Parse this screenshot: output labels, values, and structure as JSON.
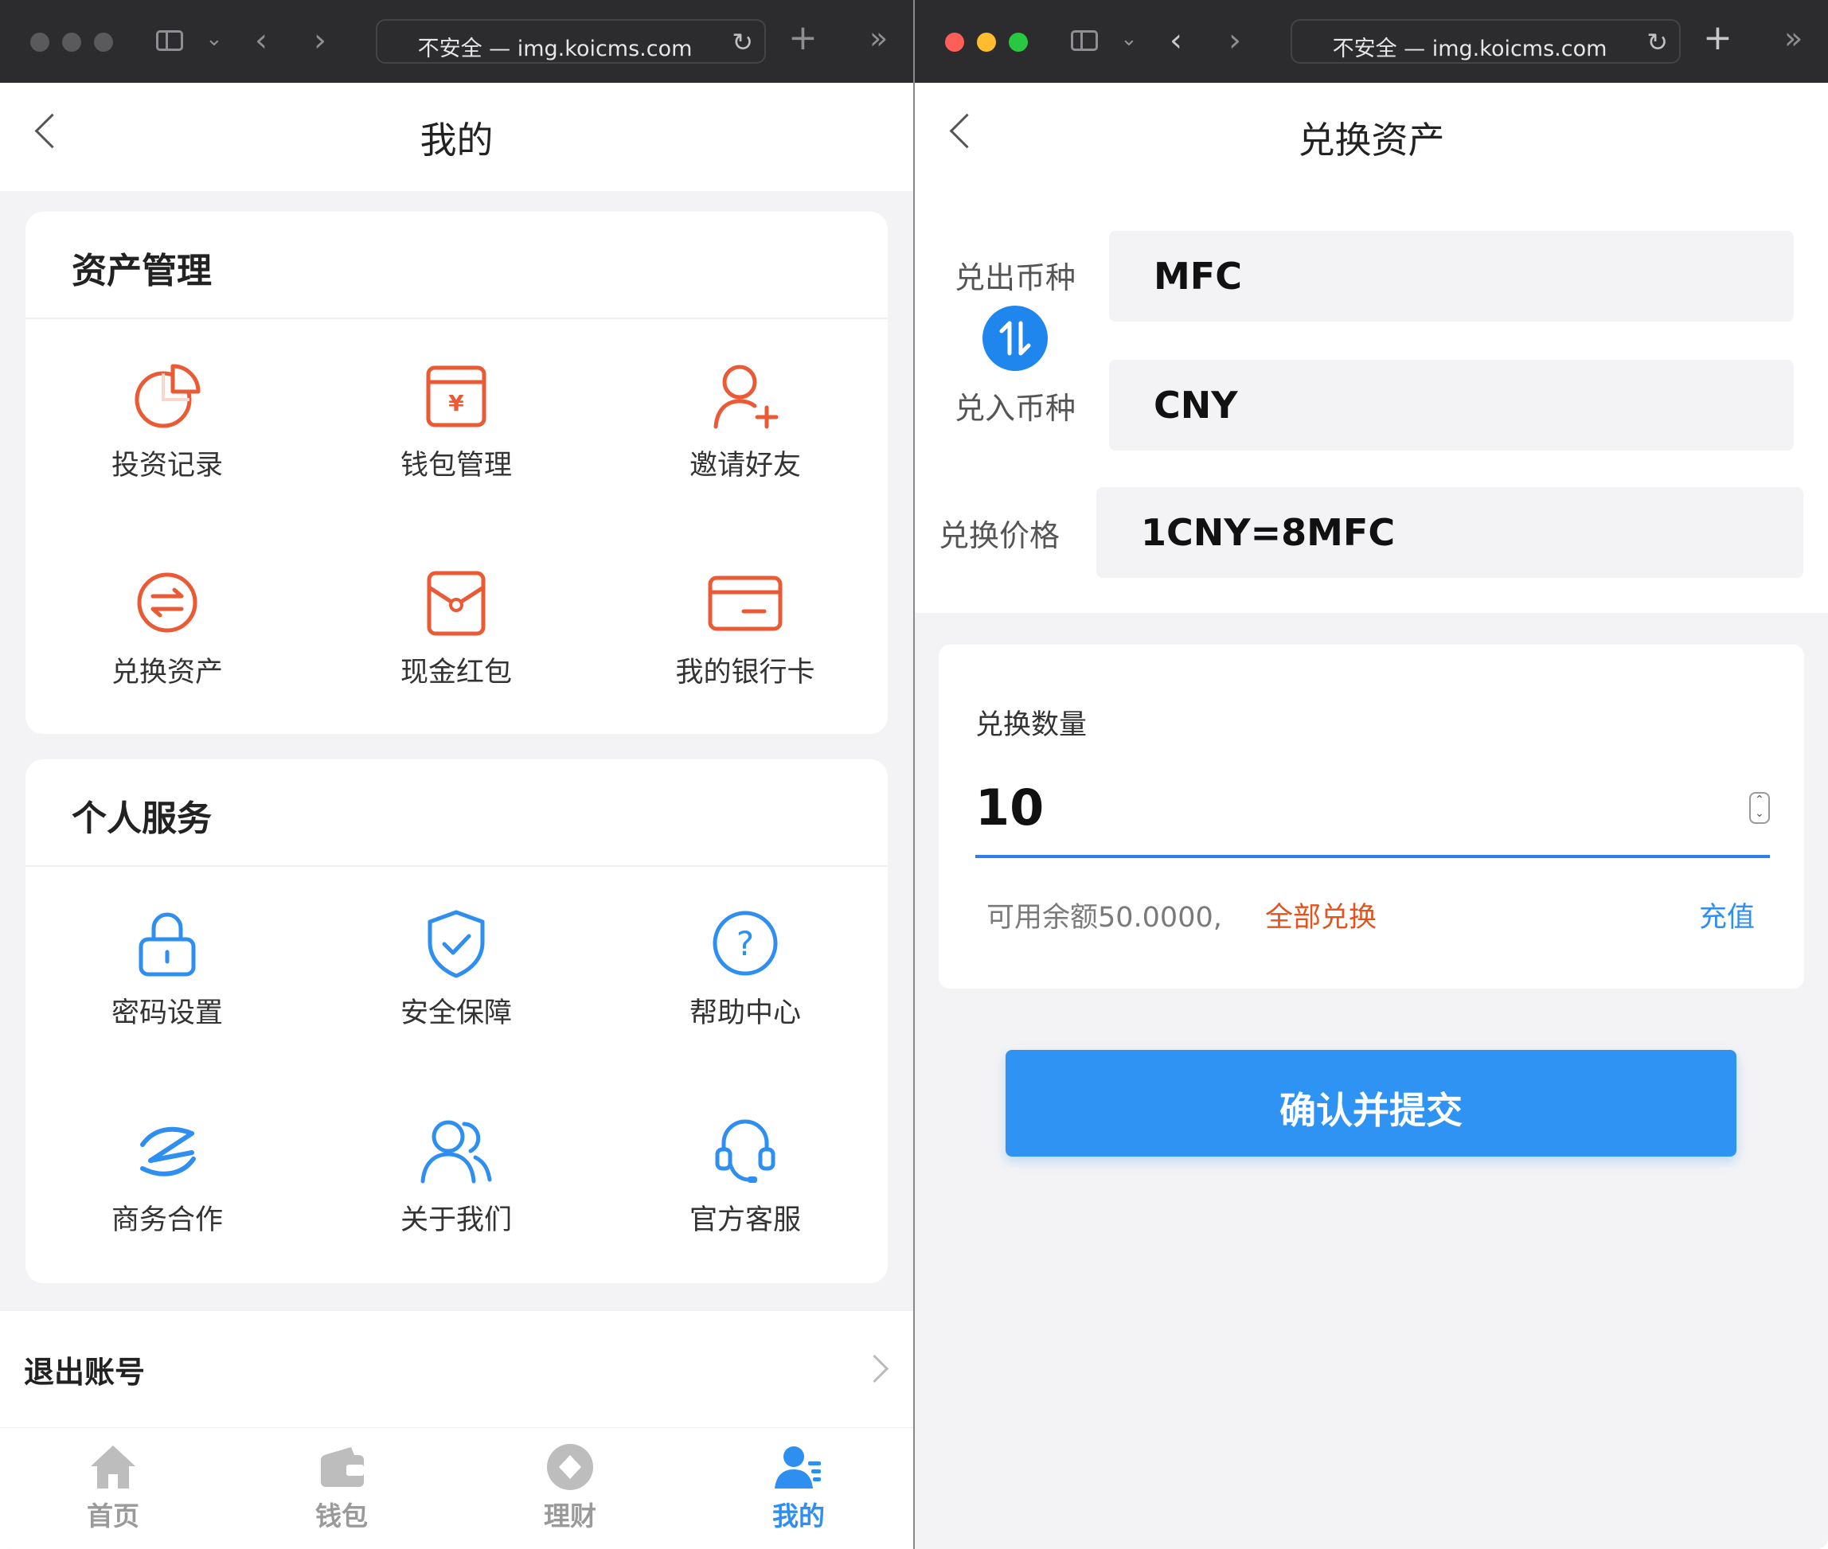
{
  "browser": {
    "url_text": "不安全 — img.koicms.com",
    "traffic_lights_colors": [
      "#ff5f57",
      "#febc2e",
      "#28c840"
    ],
    "inactive_light_color": "#5a5a5c"
  },
  "left": {
    "title": "我的",
    "asset_section": {
      "title": "资产管理",
      "items": [
        {
          "label": "投资记录",
          "icon": "pie-chart-icon"
        },
        {
          "label": "钱包管理",
          "icon": "wallet-yen-icon"
        },
        {
          "label": "邀请好友",
          "icon": "add-user-icon"
        },
        {
          "label": "兑换资产",
          "icon": "exchange-icon"
        },
        {
          "label": "现金红包",
          "icon": "red-packet-icon"
        },
        {
          "label": "我的银行卡",
          "icon": "bank-card-icon"
        }
      ]
    },
    "service_section": {
      "title": "个人服务",
      "items": [
        {
          "label": "密码设置",
          "icon": "lock-icon"
        },
        {
          "label": "安全保障",
          "icon": "shield-check-icon"
        },
        {
          "label": "帮助中心",
          "icon": "help-icon"
        },
        {
          "label": "商务合作",
          "icon": "cooperation-icon"
        },
        {
          "label": "关于我们",
          "icon": "users-icon"
        },
        {
          "label": "官方客服",
          "icon": "headset-icon"
        }
      ]
    },
    "logout_label": "退出账号",
    "tabs": [
      {
        "label": "首页",
        "icon": "home-icon",
        "active": false
      },
      {
        "label": "钱包",
        "icon": "wallet-icon",
        "active": false
      },
      {
        "label": "理财",
        "icon": "finance-icon",
        "active": false
      },
      {
        "label": "我的",
        "icon": "profile-icon",
        "active": true
      }
    ],
    "colors": {
      "asset_icon": "#ea5a35",
      "service_icon": "#2f8ff0",
      "tab_active": "#2f8ff0",
      "tab_inactive": "#9a9a9a"
    }
  },
  "right": {
    "title": "兑换资产",
    "from_label": "兑出币种",
    "from_value": "MFC",
    "to_label": "兑入币种",
    "to_value": "CNY",
    "price_label": "兑换价格",
    "price_value": "1CNY=8MFC",
    "qty_label": "兑换数量",
    "qty_value": "10",
    "balance_text": "可用余额50.0000,",
    "all_exchange": "全部兑换",
    "recharge": "充值",
    "submit": "确认并提交",
    "colors": {
      "primary": "#2f93f3",
      "accent": "#e2531e"
    }
  }
}
